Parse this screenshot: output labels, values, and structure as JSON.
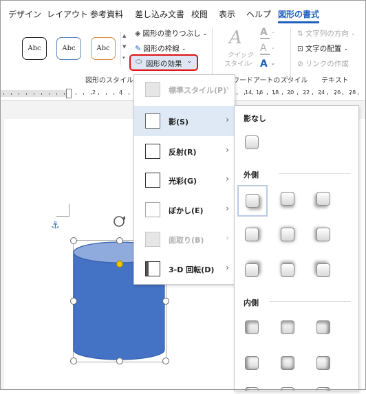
{
  "tabs": [
    {
      "label": "デザイン"
    },
    {
      "label": "レイアウト"
    },
    {
      "label": "参考資料"
    },
    {
      "label": "差し込み文書"
    },
    {
      "label": "校閲"
    },
    {
      "label": "表示"
    },
    {
      "label": "ヘルプ"
    },
    {
      "label": "図形の書式",
      "active": true
    }
  ],
  "ribbon": {
    "style_samples": [
      "Abc",
      "Abc",
      "Abc"
    ],
    "shape_fill": "図形の塗りつぶし",
    "shape_outline": "図形の枠線",
    "shape_effects": "図形の効果",
    "shape_styles_group": "図形のスタイル",
    "quick_styles_line1": "クイック",
    "quick_styles_line2": "スタイル",
    "wordart_group": "ワードアートのスタイル",
    "text_direction": "文字列の方向",
    "text_align": "文字の配置",
    "create_link": "リンクの作成",
    "text_group": "テキスト"
  },
  "ruler": {
    "numbers": [
      "2",
      "4",
      "14",
      "16",
      "18",
      "20",
      "22",
      "24",
      "26",
      "28"
    ]
  },
  "effects_menu": {
    "items": [
      {
        "label": "標準スタイル(P)",
        "disabled": true
      },
      {
        "label": "影(S)",
        "selected": true
      },
      {
        "label": "反射(R)"
      },
      {
        "label": "光彩(G)"
      },
      {
        "label": "ぼかし(E)"
      },
      {
        "label": "面取り(B)",
        "disabled": true
      },
      {
        "label": "3-D 回転(D)"
      }
    ]
  },
  "shadow_submenu": {
    "no_shadow": "影なし",
    "outer": "外側",
    "inner": "内側"
  },
  "colors": {
    "accent": "#1f5fbf",
    "highlight_border": "#e01010",
    "cylinder_fill": "#4472c4",
    "cylinder_top": "#8faadc",
    "selected_bg": "#dfe9f6"
  }
}
